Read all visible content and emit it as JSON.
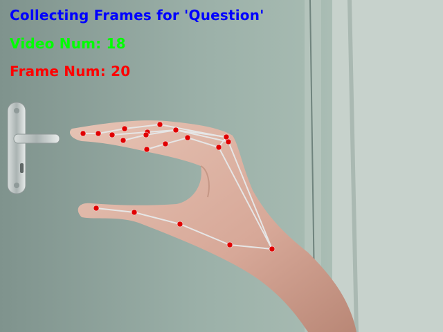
{
  "overlay": {
    "title": "Collecting Frames for 'Question'",
    "video_num": "Video Num: 18",
    "frame_num": "Frame Num: 20"
  },
  "colors": {
    "title": "#0000ff",
    "video": "#00ff00",
    "frame": "#ff0000",
    "landmark_point": "#e00000",
    "landmark_line": "#e6e6e6"
  },
  "icons": [
    "door-handle",
    "hand-landmarks"
  ]
}
